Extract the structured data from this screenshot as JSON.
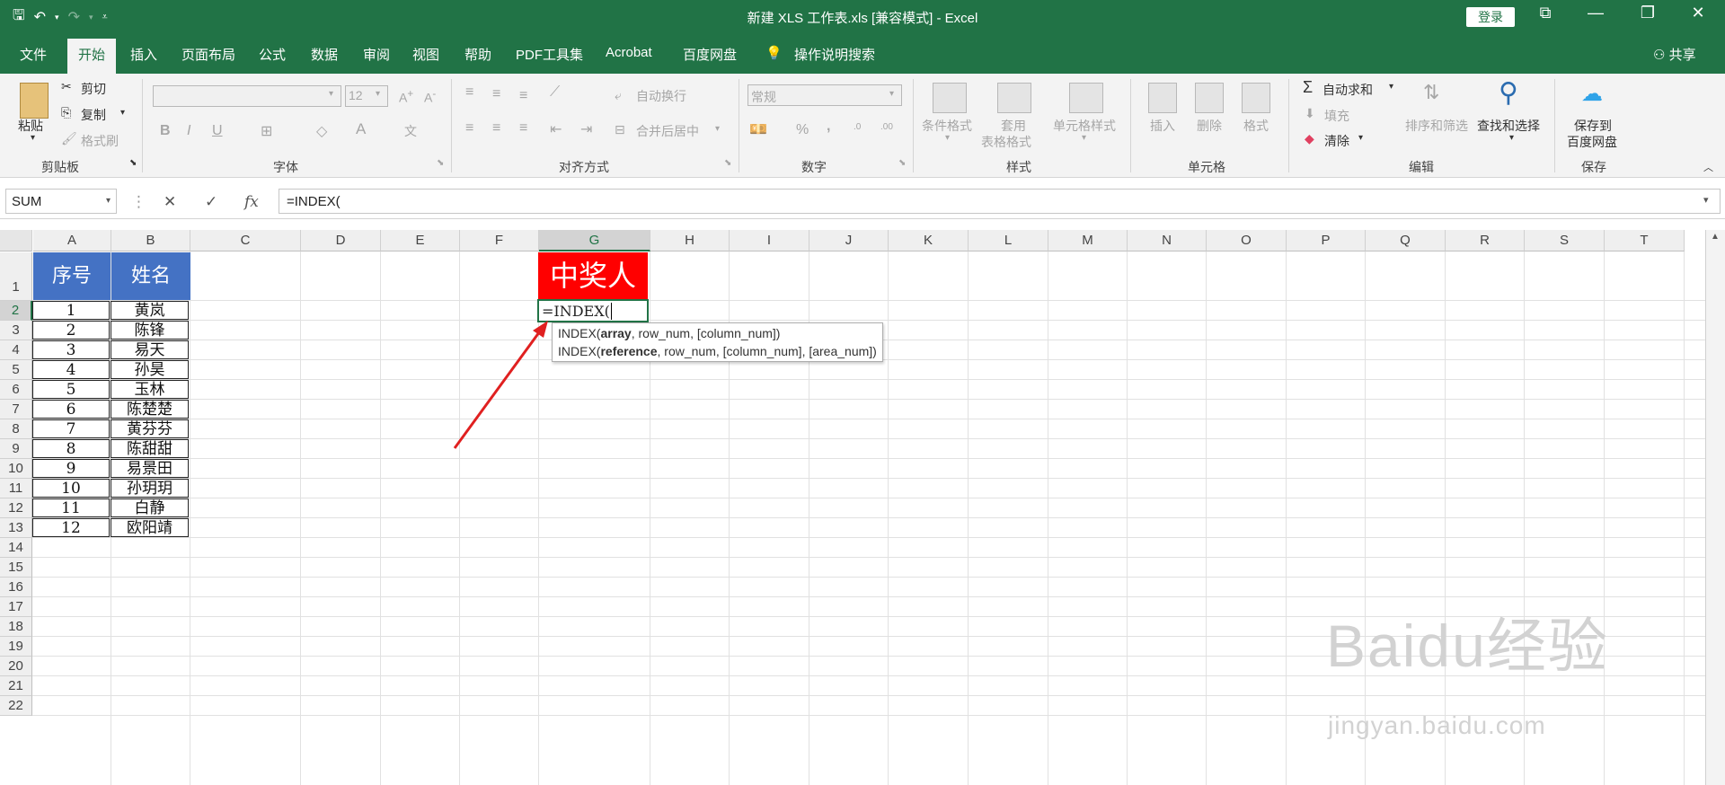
{
  "window": {
    "title": "新建 XLS 工作表.xls  [兼容模式]  -  Excel",
    "login_label": "登录",
    "share_label": "共享"
  },
  "menu": {
    "tabs": [
      "文件",
      "开始",
      "插入",
      "页面布局",
      "公式",
      "数据",
      "审阅",
      "视图",
      "帮助",
      "PDF工具集",
      "Acrobat",
      "百度网盘"
    ],
    "active": "开始",
    "tell_me": "操作说明搜索"
  },
  "ribbon": {
    "clipboard": {
      "paste": "粘贴",
      "cut": "剪切",
      "copy": "复制",
      "format_painter": "格式刷",
      "label": "剪贴板"
    },
    "font": {
      "size": "12",
      "label": "字体",
      "bold": "B",
      "italic": "I",
      "underline": "U"
    },
    "alignment": {
      "wrap": "自动换行",
      "merge": "合并后居中",
      "label": "对齐方式"
    },
    "number": {
      "format": "常规",
      "label": "数字",
      "percent": "%",
      "comma": ","
    },
    "styles": {
      "conditional": "条件格式",
      "table_line1": "套用",
      "table_line2": "表格格式",
      "cell_styles": "单元格样式",
      "label": "样式"
    },
    "cells": {
      "insert": "插入",
      "delete": "删除",
      "format": "格式",
      "label": "单元格"
    },
    "editing": {
      "autosum": "自动求和",
      "fill": "填充",
      "clear": "清除",
      "sort": "排序和筛选",
      "find": "查找和选择",
      "label": "编辑"
    },
    "save": {
      "line1": "保存到",
      "line2": "百度网盘",
      "label": "保存"
    }
  },
  "formula_bar": {
    "name_box": "SUM",
    "formula": "=INDEX(",
    "fx": "fx"
  },
  "columns": [
    "A",
    "B",
    "C",
    "D",
    "E",
    "F",
    "G",
    "H",
    "I",
    "J",
    "K",
    "L",
    "M",
    "N",
    "O",
    "P",
    "Q",
    "R",
    "S",
    "T"
  ],
  "rows": [
    "1",
    "2",
    "3",
    "4",
    "5",
    "6",
    "7",
    "8",
    "9",
    "10",
    "11",
    "12",
    "13",
    "14",
    "15",
    "16",
    "17",
    "18",
    "19",
    "20",
    "21",
    "22"
  ],
  "sheet": {
    "header": {
      "seq": "序号",
      "name": "姓名"
    },
    "records": [
      {
        "seq": "1",
        "name": "黄岚"
      },
      {
        "seq": "2",
        "name": "陈锋"
      },
      {
        "seq": "3",
        "name": "易天"
      },
      {
        "seq": "4",
        "name": "孙昊"
      },
      {
        "seq": "5",
        "name": "玉林"
      },
      {
        "seq": "6",
        "name": "陈楚楚"
      },
      {
        "seq": "7",
        "name": "黄芬芬"
      },
      {
        "seq": "8",
        "name": "陈甜甜"
      },
      {
        "seq": "9",
        "name": "易景田"
      },
      {
        "seq": "10",
        "name": "孙玥玥"
      },
      {
        "seq": "11",
        "name": "白静"
      },
      {
        "seq": "12",
        "name": "欧阳靖"
      }
    ],
    "prize_header": "中奖人",
    "editing_cell": "=INDEX("
  },
  "tooltip": {
    "line1_pre": "INDEX(",
    "line1_bold": "array",
    "line1_post": ", row_num, [column_num])",
    "line2_pre": "INDEX(",
    "line2_bold": "reference",
    "line2_post": ", row_num, [column_num], [area_num])"
  },
  "watermark": {
    "brand": "Baidu",
    "brand_cn": "经验",
    "url": "jingyan.baidu.com"
  },
  "colors": {
    "excel_green": "#217346",
    "header_blue": "#4472c4",
    "prize_red": "#ff0000",
    "arrow_red": "#e02020"
  }
}
